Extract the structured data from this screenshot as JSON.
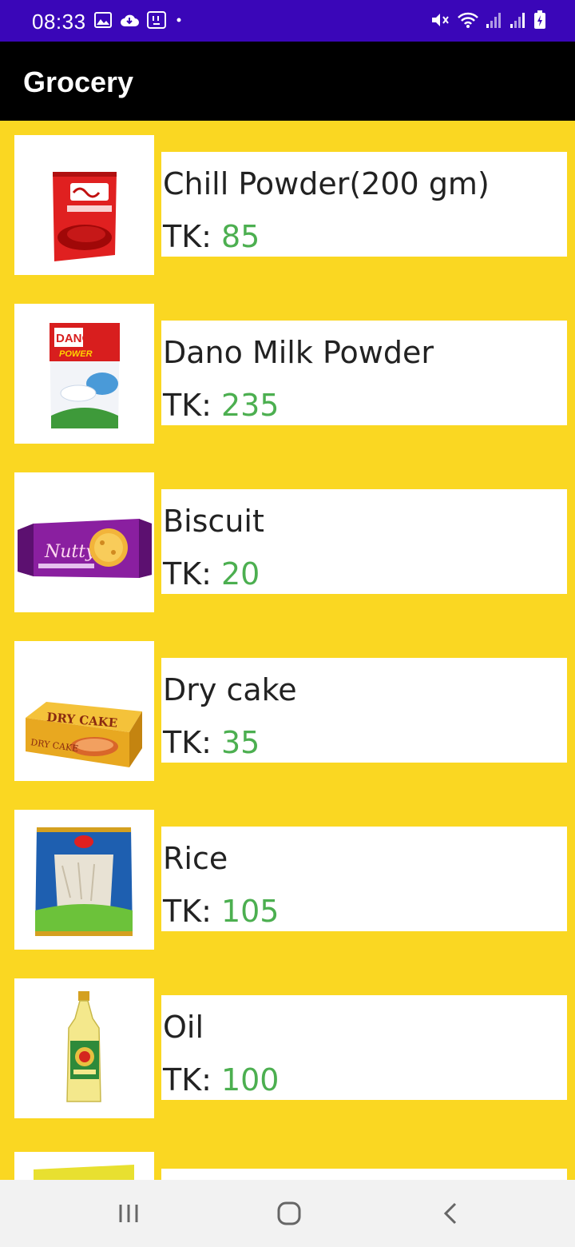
{
  "status_bar": {
    "time": "08:33",
    "left_icons": [
      "image-icon",
      "cloud-icon",
      "voicemail-icon",
      "dot-icon"
    ],
    "right_icons": [
      "mute-icon",
      "wifi-icon",
      "signal-icon",
      "signal-icon",
      "battery-icon"
    ],
    "background": "#3A06B8"
  },
  "app_bar": {
    "title": "Grocery",
    "background": "#000000"
  },
  "list": {
    "background": "#FAD722",
    "price_color": "#4CAF50",
    "items": [
      {
        "name": "Chill Powder(200 gm)",
        "price_label": "TK:",
        "price": "85",
        "image": "chili-powder-pack"
      },
      {
        "name": "Dano Milk Powder",
        "price_label": "TK:",
        "price": "235",
        "image": "dano-milk-pack"
      },
      {
        "name": "Biscuit",
        "price_label": "TK:",
        "price": "20",
        "image": "biscuit-pack"
      },
      {
        "name": "Dry cake",
        "price_label": "TK:",
        "price": "35",
        "image": "dry-cake-box"
      },
      {
        "name": "Rice",
        "price_label": "TK:",
        "price": "105",
        "image": "rice-bag"
      },
      {
        "name": "Oil",
        "price_label": "TK:",
        "price": "100",
        "image": "oil-bottle"
      },
      {
        "name": "",
        "price_label": "",
        "price": "",
        "image": "yellow-pack"
      }
    ]
  },
  "nav_bar": {
    "buttons": [
      "recent-apps-icon",
      "home-icon",
      "back-icon"
    ]
  }
}
